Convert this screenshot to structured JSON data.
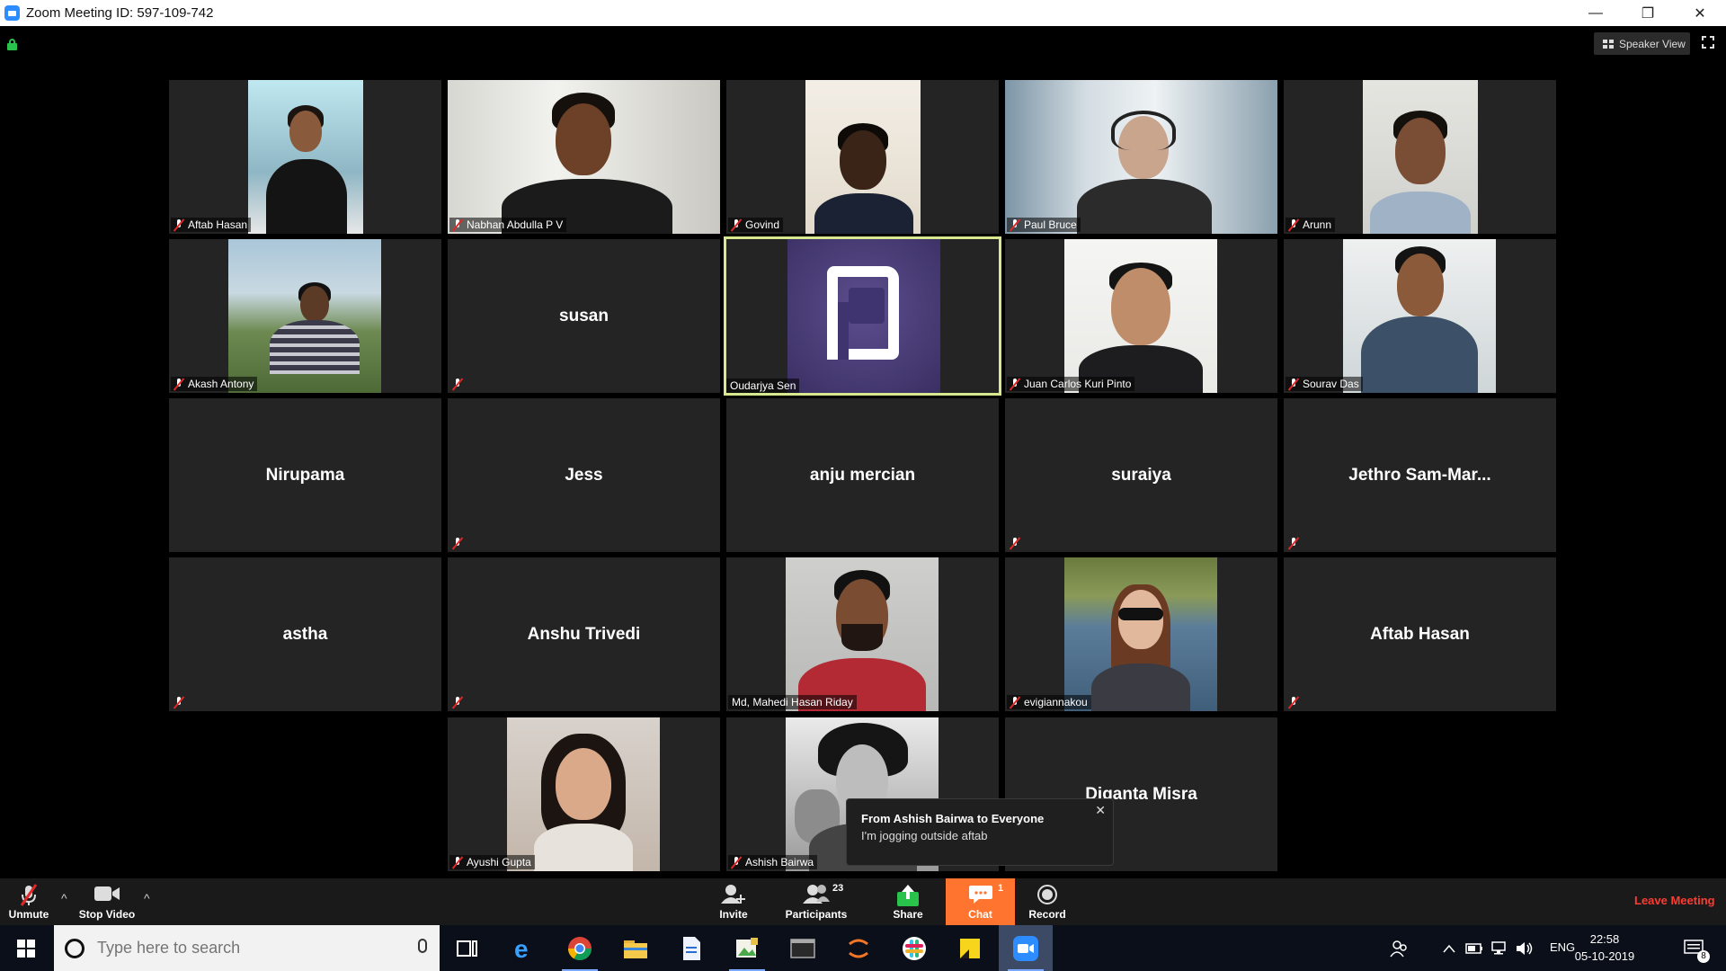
{
  "window": {
    "title": "Zoom Meeting ID: 597-109-742",
    "minimize": "—",
    "restore": "❐",
    "close": "✕"
  },
  "view": {
    "speaker_view_label": "Speaker View"
  },
  "participants": [
    {
      "name": "Aftab Hasan",
      "video": true,
      "muted": true
    },
    {
      "name": "Nabhan Abdulla P V",
      "video": true,
      "muted": true
    },
    {
      "name": "Govind",
      "video": true,
      "muted": true
    },
    {
      "name": "Paul Bruce",
      "video": true,
      "muted": true
    },
    {
      "name": "Arunn",
      "video": true,
      "muted": true
    },
    {
      "name": "Akash Antony",
      "video": true,
      "muted": true
    },
    {
      "name": "susan",
      "video": false,
      "muted": true
    },
    {
      "name": "Oudarjya Sen",
      "video": true,
      "muted": false,
      "active_speaker": true
    },
    {
      "name": "Juan Carlos Kuri Pinto",
      "video": true,
      "muted": true
    },
    {
      "name": "Sourav Das",
      "video": true,
      "muted": true
    },
    {
      "name": "Nirupama",
      "video": false,
      "muted": false
    },
    {
      "name": "Jess",
      "video": false,
      "muted": true
    },
    {
      "name": "anju mercian",
      "video": false,
      "muted": false
    },
    {
      "name": "suraiya",
      "video": false,
      "muted": true
    },
    {
      "name": "Jethro  Sam-Mar...",
      "video": false,
      "muted": true
    },
    {
      "name": "astha",
      "video": false,
      "muted": true
    },
    {
      "name": "Anshu Trivedi",
      "video": false,
      "muted": true
    },
    {
      "name": "Md, Mahedi Hasan Riday",
      "video": true,
      "muted": false
    },
    {
      "name": "evigiannakou",
      "video": true,
      "muted": true
    },
    {
      "name": "Aftab Hasan",
      "video": false,
      "muted": true
    },
    {
      "name": "Ayushi Gupta",
      "video": true,
      "muted": true
    },
    {
      "name": "Ashish Bairwa",
      "video": true,
      "muted": true
    },
    {
      "name": "Diganta Misra",
      "video": false,
      "muted": true
    }
  ],
  "chat_popup": {
    "from": "From Ashish Bairwa to Everyone",
    "message": "I'm jogging outside aftab",
    "close": "✕"
  },
  "toolbar": {
    "unmute": "Unmute",
    "stop_video": "Stop Video",
    "invite": "Invite",
    "participants": "Participants",
    "participants_count": "23",
    "share": "Share",
    "chat": "Chat",
    "chat_badge": "1",
    "record": "Record",
    "leave": "Leave Meeting",
    "caret": "^"
  },
  "taskbar": {
    "search_placeholder": "Type here to search",
    "language": "ENG",
    "time": "22:58",
    "date": "05-10-2019",
    "notification_count": "8"
  },
  "colors": {
    "accent_orange": "#ff742e",
    "active_border": "#d7e88f",
    "leave_red": "#ff3b30",
    "share_green": "#29c24a"
  }
}
